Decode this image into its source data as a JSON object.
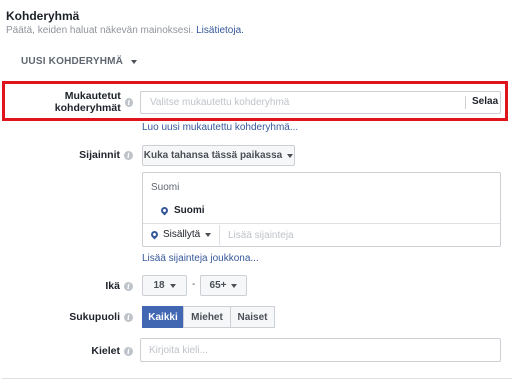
{
  "header": {
    "title": "Kohderyhmä",
    "subtitle": "Päätä, keiden haluat näkevän mainoksesi.",
    "subtitle_link": "Lisätietoja."
  },
  "new_audience": {
    "label": "UUSI KOHDERYHMÄ"
  },
  "custom_audiences": {
    "label": "Mukautetut kohderyhmät",
    "placeholder": "Valitse mukautettu kohderyhmä",
    "browse_label": "Selaa",
    "create_link": "Luo uusi mukautettu kohderyhmä..."
  },
  "locations": {
    "label": "Sijainnit",
    "dropdown_value": "Kuka tahansa tässä paikassa",
    "country_header": "Suomi",
    "selected_location": "Suomi",
    "include_label": "Sisällytä",
    "location_placeholder": "Lisää sijainteja",
    "bulk_link": "Lisää sijainteja joukkona..."
  },
  "age": {
    "label": "Ikä",
    "min": "18",
    "separator": "-",
    "max": "65+"
  },
  "gender": {
    "label": "Sukupuoli",
    "options": [
      "Kaikki",
      "Miehet",
      "Naiset"
    ],
    "selected": "Kaikki"
  },
  "languages": {
    "label": "Kielet",
    "placeholder": "Kirjoita kieli..."
  },
  "colors": {
    "highlight": "#e0141c",
    "link": "#365899",
    "active_button": "#4267b2"
  }
}
